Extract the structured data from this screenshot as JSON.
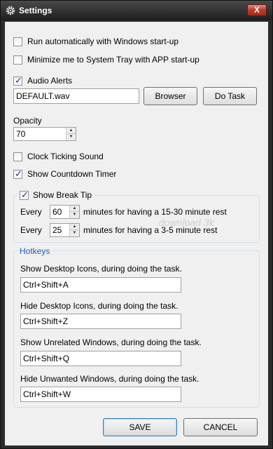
{
  "window": {
    "title": "Settings",
    "close_label": "X"
  },
  "options": {
    "run_on_startup": {
      "label": "Run automatically with Windows start-up",
      "checked": false
    },
    "minimize_to_tray": {
      "label": "Minimize me to System Tray with APP start-up",
      "checked": false
    },
    "audio_alerts": {
      "label": "Audio Alerts",
      "checked": true
    },
    "audio_file": "DEFAULT.wav",
    "browser_label": "Browser",
    "do_task_label": "Do Task",
    "opacity_label": "Opacity",
    "opacity_value": "70",
    "clock_ticking": {
      "label": "Clock Ticking Sound",
      "checked": false
    },
    "countdown_timer": {
      "label": "Show Countdown Timer",
      "checked": true
    }
  },
  "break_tip": {
    "label": "Show Break Tip",
    "checked": true,
    "rows": [
      {
        "every": "Every",
        "value": "60",
        "text": "minutes for having a 15-30 minute rest"
      },
      {
        "every": "Every",
        "value": "25",
        "text": "minutes for having a 3-5 minute rest"
      }
    ]
  },
  "hotkeys": {
    "title": "Hotkeys",
    "title_color": "#1a5fb4",
    "items": [
      {
        "label": "Show Desktop Icons, during doing the task.",
        "value": "Ctrl+Shift+A"
      },
      {
        "label": "Hide Desktop Icons, during doing the task.",
        "value": "Ctrl+Shift+Z"
      },
      {
        "label": "Show Unrelated Windows, during doing the task.",
        "value": "Ctrl+Shift+Q"
      },
      {
        "label": "Hide Unwanted Windows, during doing the task.",
        "value": "Ctrl+Shift+W"
      }
    ]
  },
  "footer": {
    "save_label": "SAVE",
    "cancel_label": "CANCEL"
  },
  "watermark": "download 3k"
}
